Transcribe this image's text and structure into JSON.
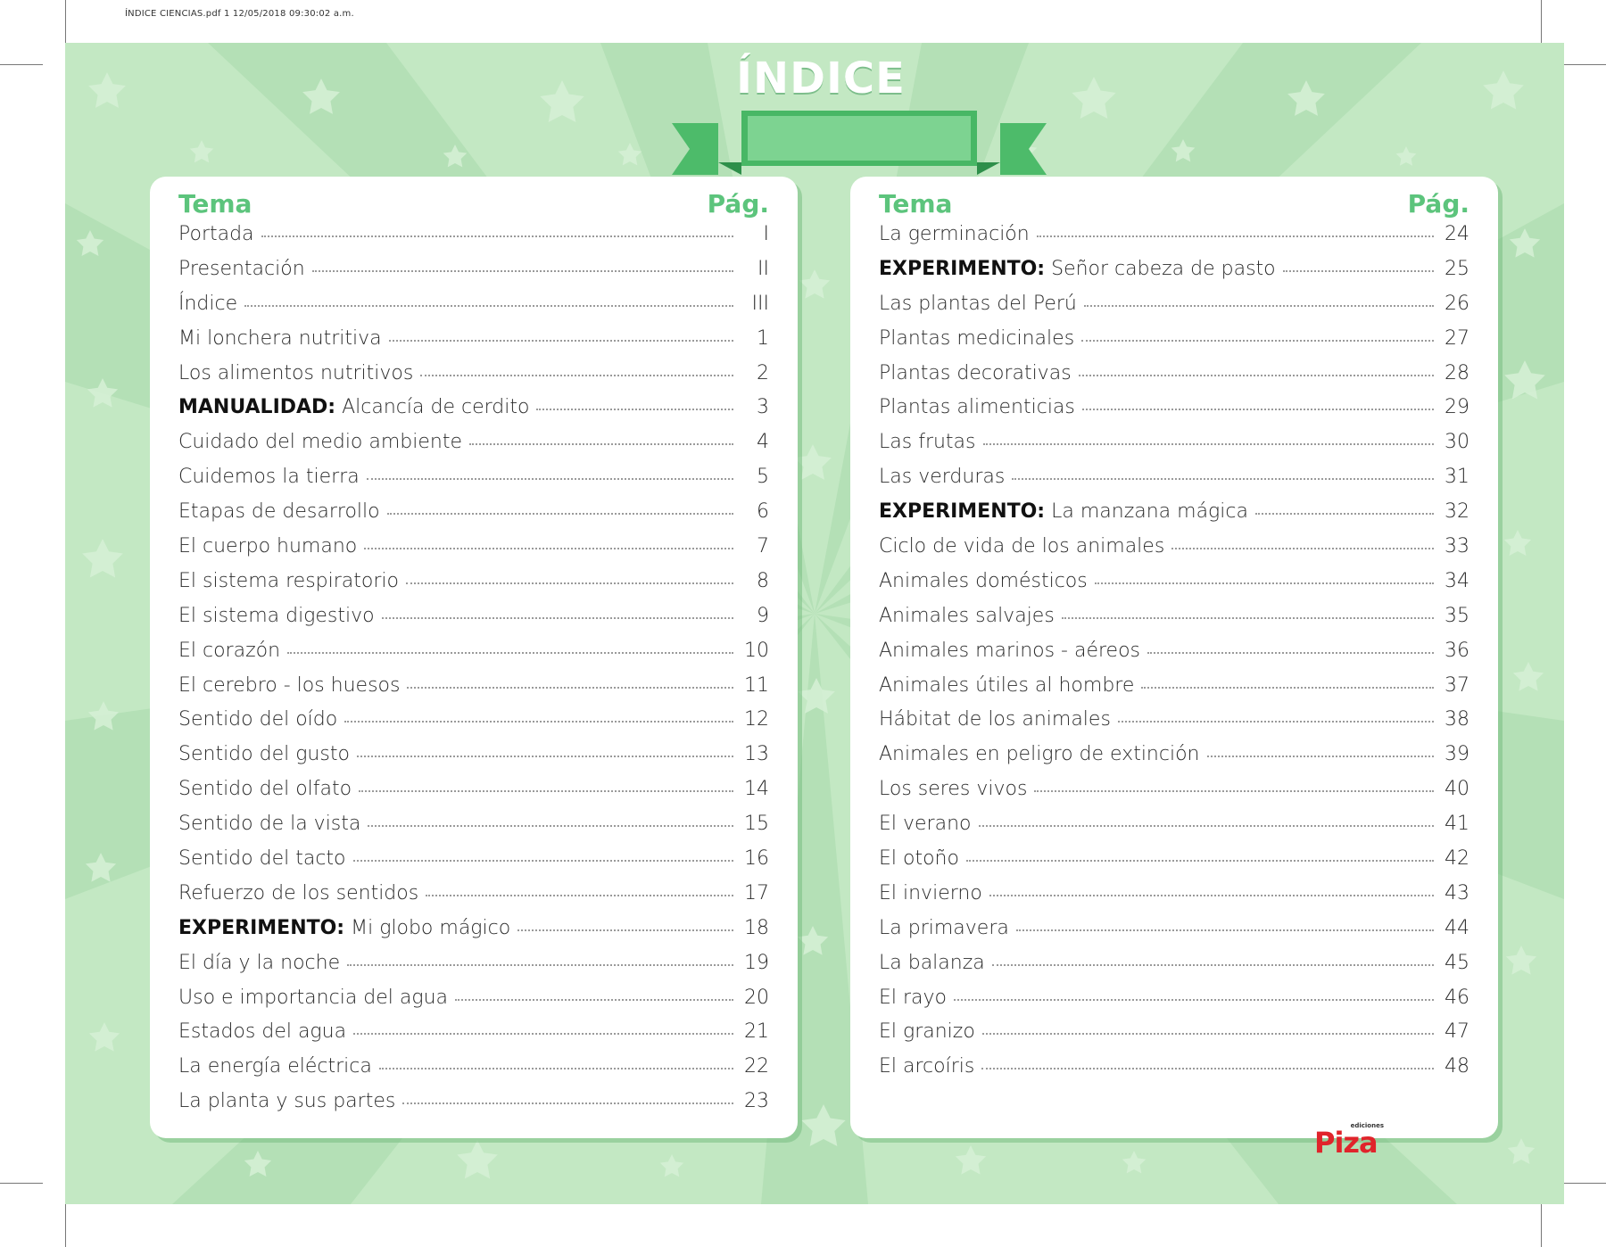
{
  "print_header": "ÍNDICE CIENCIAS.pdf   1   12/05/2018   09:30:02 a.m.",
  "title": "ÍNDICE",
  "headers": {
    "topic": "Tema",
    "page": "Pág."
  },
  "colors": {
    "background": "#c3e8c3",
    "accent": "#5cc47c",
    "banner": "#7dd391",
    "logo": "#e0242b"
  },
  "left_entries": [
    {
      "prefix": "",
      "text": "Portada",
      "page": "I"
    },
    {
      "prefix": "",
      "text": "Presentación",
      "page": "II"
    },
    {
      "prefix": "",
      "text": "Índice",
      "page": "III"
    },
    {
      "prefix": "",
      "text": "Mi lonchera nutritiva",
      "page": "1"
    },
    {
      "prefix": "",
      "text": "Los alimentos nutritivos",
      "page": "2"
    },
    {
      "prefix": "MANUALIDAD:",
      "text": "Alcancía de cerdito",
      "page": "3"
    },
    {
      "prefix": "",
      "text": "Cuidado del medio ambiente",
      "page": "4"
    },
    {
      "prefix": "",
      "text": "Cuidemos la tierra",
      "page": "5"
    },
    {
      "prefix": "",
      "text": "Etapas de desarrollo",
      "page": "6"
    },
    {
      "prefix": "",
      "text": "El cuerpo humano",
      "page": "7"
    },
    {
      "prefix": "",
      "text": "El sistema respiratorio",
      "page": "8"
    },
    {
      "prefix": "",
      "text": "El sistema digestivo",
      "page": "9"
    },
    {
      "prefix": "",
      "text": "El corazón",
      "page": "10"
    },
    {
      "prefix": "",
      "text": "El cerebro - los huesos",
      "page": "11"
    },
    {
      "prefix": "",
      "text": "Sentido del oído",
      "page": "12"
    },
    {
      "prefix": "",
      "text": "Sentido del gusto",
      "page": "13"
    },
    {
      "prefix": "",
      "text": "Sentido del olfato",
      "page": "14"
    },
    {
      "prefix": "",
      "text": "Sentido de la vista",
      "page": "15"
    },
    {
      "prefix": "",
      "text": "Sentido del tacto",
      "page": "16"
    },
    {
      "prefix": "",
      "text": "Refuerzo de los sentidos",
      "page": "17"
    },
    {
      "prefix": "EXPERIMENTO:",
      "text": "Mi globo mágico",
      "page": "18"
    },
    {
      "prefix": "",
      "text": "El día y la noche",
      "page": "19"
    },
    {
      "prefix": "",
      "text": "Uso e importancia del agua",
      "page": "20"
    },
    {
      "prefix": "",
      "text": "Estados del agua",
      "page": "21"
    },
    {
      "prefix": "",
      "text": "La energía eléctrica",
      "page": "22"
    },
    {
      "prefix": "",
      "text": "La planta y sus partes",
      "page": "23"
    }
  ],
  "right_entries": [
    {
      "prefix": "",
      "text": "La germinación",
      "page": "24"
    },
    {
      "prefix": "EXPERIMENTO:",
      "text": "Señor cabeza de pasto",
      "page": "25"
    },
    {
      "prefix": "",
      "text": "Las plantas del Perú",
      "page": "26"
    },
    {
      "prefix": "",
      "text": "Plantas medicinales",
      "page": "27"
    },
    {
      "prefix": "",
      "text": "Plantas decorativas",
      "page": "28"
    },
    {
      "prefix": "",
      "text": "Plantas alimenticias",
      "page": "29"
    },
    {
      "prefix": "",
      "text": "Las frutas",
      "page": "30"
    },
    {
      "prefix": "",
      "text": "Las verduras",
      "page": "31"
    },
    {
      "prefix": "EXPERIMENTO:",
      "text": "La manzana mágica",
      "page": "32"
    },
    {
      "prefix": "",
      "text": "Ciclo de vida de los animales",
      "page": "33"
    },
    {
      "prefix": "",
      "text": "Animales domésticos",
      "page": "34"
    },
    {
      "prefix": "",
      "text": "Animales salvajes",
      "page": "35"
    },
    {
      "prefix": "",
      "text": "Animales marinos - aéreos",
      "page": "36"
    },
    {
      "prefix": "",
      "text": "Animales útiles al hombre",
      "page": "37"
    },
    {
      "prefix": "",
      "text": "Hábitat de los animales",
      "page": "38"
    },
    {
      "prefix": "",
      "text": "Animales en peligro de extinción",
      "page": "39"
    },
    {
      "prefix": "",
      "text": "Los seres vivos",
      "page": "40"
    },
    {
      "prefix": "",
      "text": "El verano",
      "page": "41"
    },
    {
      "prefix": "",
      "text": "El otoño",
      "page": "42"
    },
    {
      "prefix": "",
      "text": "El invierno",
      "page": "43"
    },
    {
      "prefix": "",
      "text": "La primavera",
      "page": "44"
    },
    {
      "prefix": "",
      "text": "La balanza",
      "page": "45"
    },
    {
      "prefix": "",
      "text": "El rayo",
      "page": "46"
    },
    {
      "prefix": "",
      "text": "El granizo",
      "page": "47"
    },
    {
      "prefix": "",
      "text": "El arcoíris",
      "page": "48"
    }
  ],
  "logo": {
    "word": "Piza",
    "tagline": "ediciones"
  }
}
